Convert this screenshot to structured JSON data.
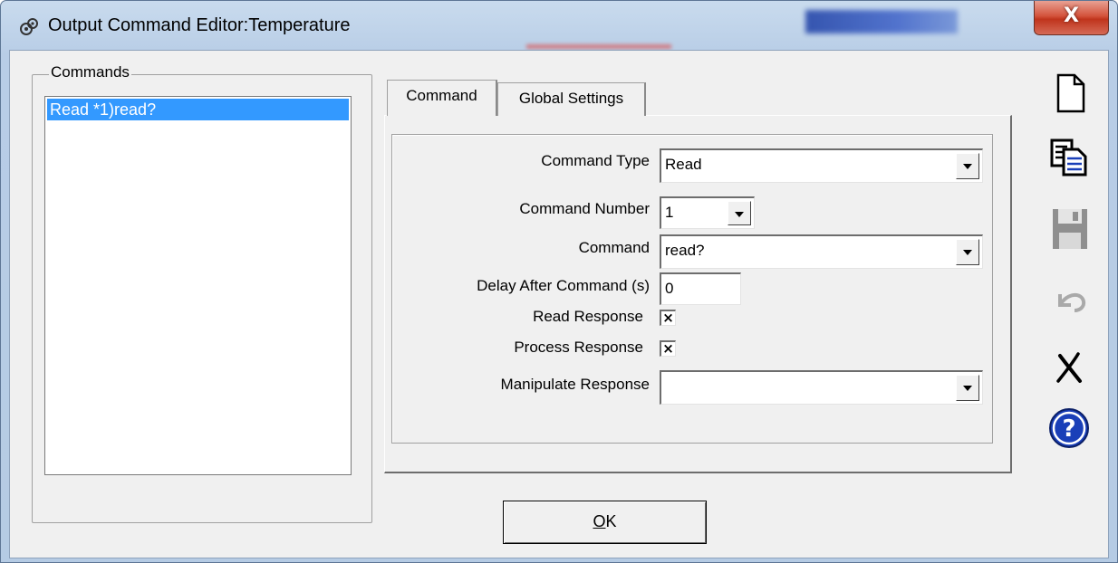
{
  "window": {
    "title": "Output Command Editor:Temperature",
    "close_label": "X"
  },
  "commands_group": {
    "label": "Commands",
    "items": [
      {
        "label": "Read *1)read?",
        "selected": true
      }
    ]
  },
  "tabs": [
    {
      "label": "Command",
      "active": true
    },
    {
      "label": "Global Settings",
      "active": false
    }
  ],
  "form": {
    "command_type": {
      "label": "Command Type",
      "value": "Read"
    },
    "command_number": {
      "label": "Command Number",
      "value": "1"
    },
    "command": {
      "label": "Command",
      "value": "read?"
    },
    "delay": {
      "label": "Delay After Command (s)",
      "value": "0"
    },
    "read_response": {
      "label": "Read Response",
      "checked": true,
      "mark": "×"
    },
    "process_response": {
      "label": "Process Response",
      "checked": true,
      "mark": "×"
    },
    "manipulate_response": {
      "label": "Manipulate Response",
      "value": ""
    }
  },
  "buttons": {
    "ok_underlined": "O",
    "ok_rest": "K"
  },
  "toolbar": {
    "icons": [
      "new-document-icon",
      "copy-icon",
      "save-icon",
      "undo-icon",
      "delete-icon",
      "help-icon"
    ],
    "help_glyph": "?",
    "delete_glyph": "✕"
  },
  "colors": {
    "selection": "#3399ff",
    "help_blue": "#1a3fb8",
    "close_red": "#c9402a"
  }
}
